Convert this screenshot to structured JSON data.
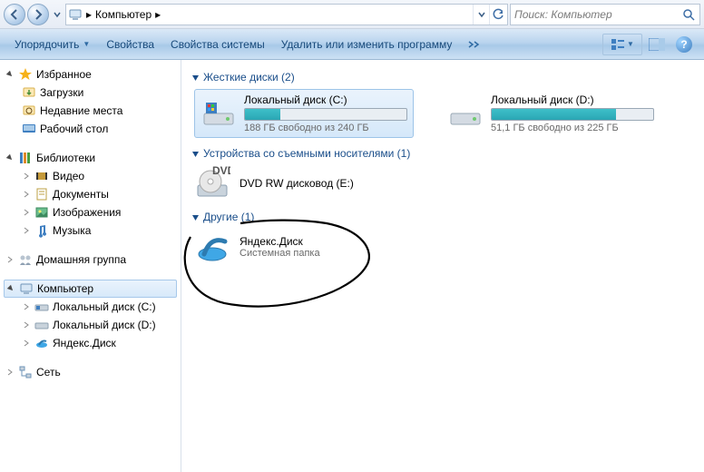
{
  "addressbar": {
    "location_text": "Компьютер",
    "separator": "▸"
  },
  "search": {
    "placeholder": "Поиск: Компьютер"
  },
  "commandbar": {
    "organize": "Упорядочить",
    "properties": "Свойства",
    "system_properties": "Свойства системы",
    "uninstall": "Удалить или изменить программу"
  },
  "sidebar": {
    "favorites": {
      "label": "Избранное",
      "items": [
        {
          "label": "Загрузки"
        },
        {
          "label": "Недавние места"
        },
        {
          "label": "Рабочий стол"
        }
      ]
    },
    "libraries": {
      "label": "Библиотеки",
      "items": [
        {
          "label": "Видео"
        },
        {
          "label": "Документы"
        },
        {
          "label": "Изображения"
        },
        {
          "label": "Музыка"
        }
      ]
    },
    "homegroup": {
      "label": "Домашняя группа"
    },
    "computer": {
      "label": "Компьютер",
      "items": [
        {
          "label": "Локальный диск (C:)"
        },
        {
          "label": "Локальный диск (D:)"
        },
        {
          "label": "Яндекс.Диск"
        }
      ]
    },
    "network": {
      "label": "Сеть"
    }
  },
  "sections": {
    "hdd": {
      "label": "Жесткие диски (2)"
    },
    "removable": {
      "label": "Устройства со съемными носителями (1)"
    },
    "other": {
      "label": "Другие (1)"
    }
  },
  "drives": {
    "c": {
      "label": "Локальный диск (C:)",
      "free_text": "188 ГБ свободно из 240 ГБ",
      "fill_pct": 22
    },
    "d": {
      "label": "Локальный диск (D:)",
      "free_text": "51,1 ГБ свободно из 225 ГБ",
      "fill_pct": 77
    }
  },
  "dvd": {
    "label": "DVD RW дисковод (E:)"
  },
  "yadisk": {
    "label": "Яндекс.Диск",
    "sub": "Системная папка"
  }
}
